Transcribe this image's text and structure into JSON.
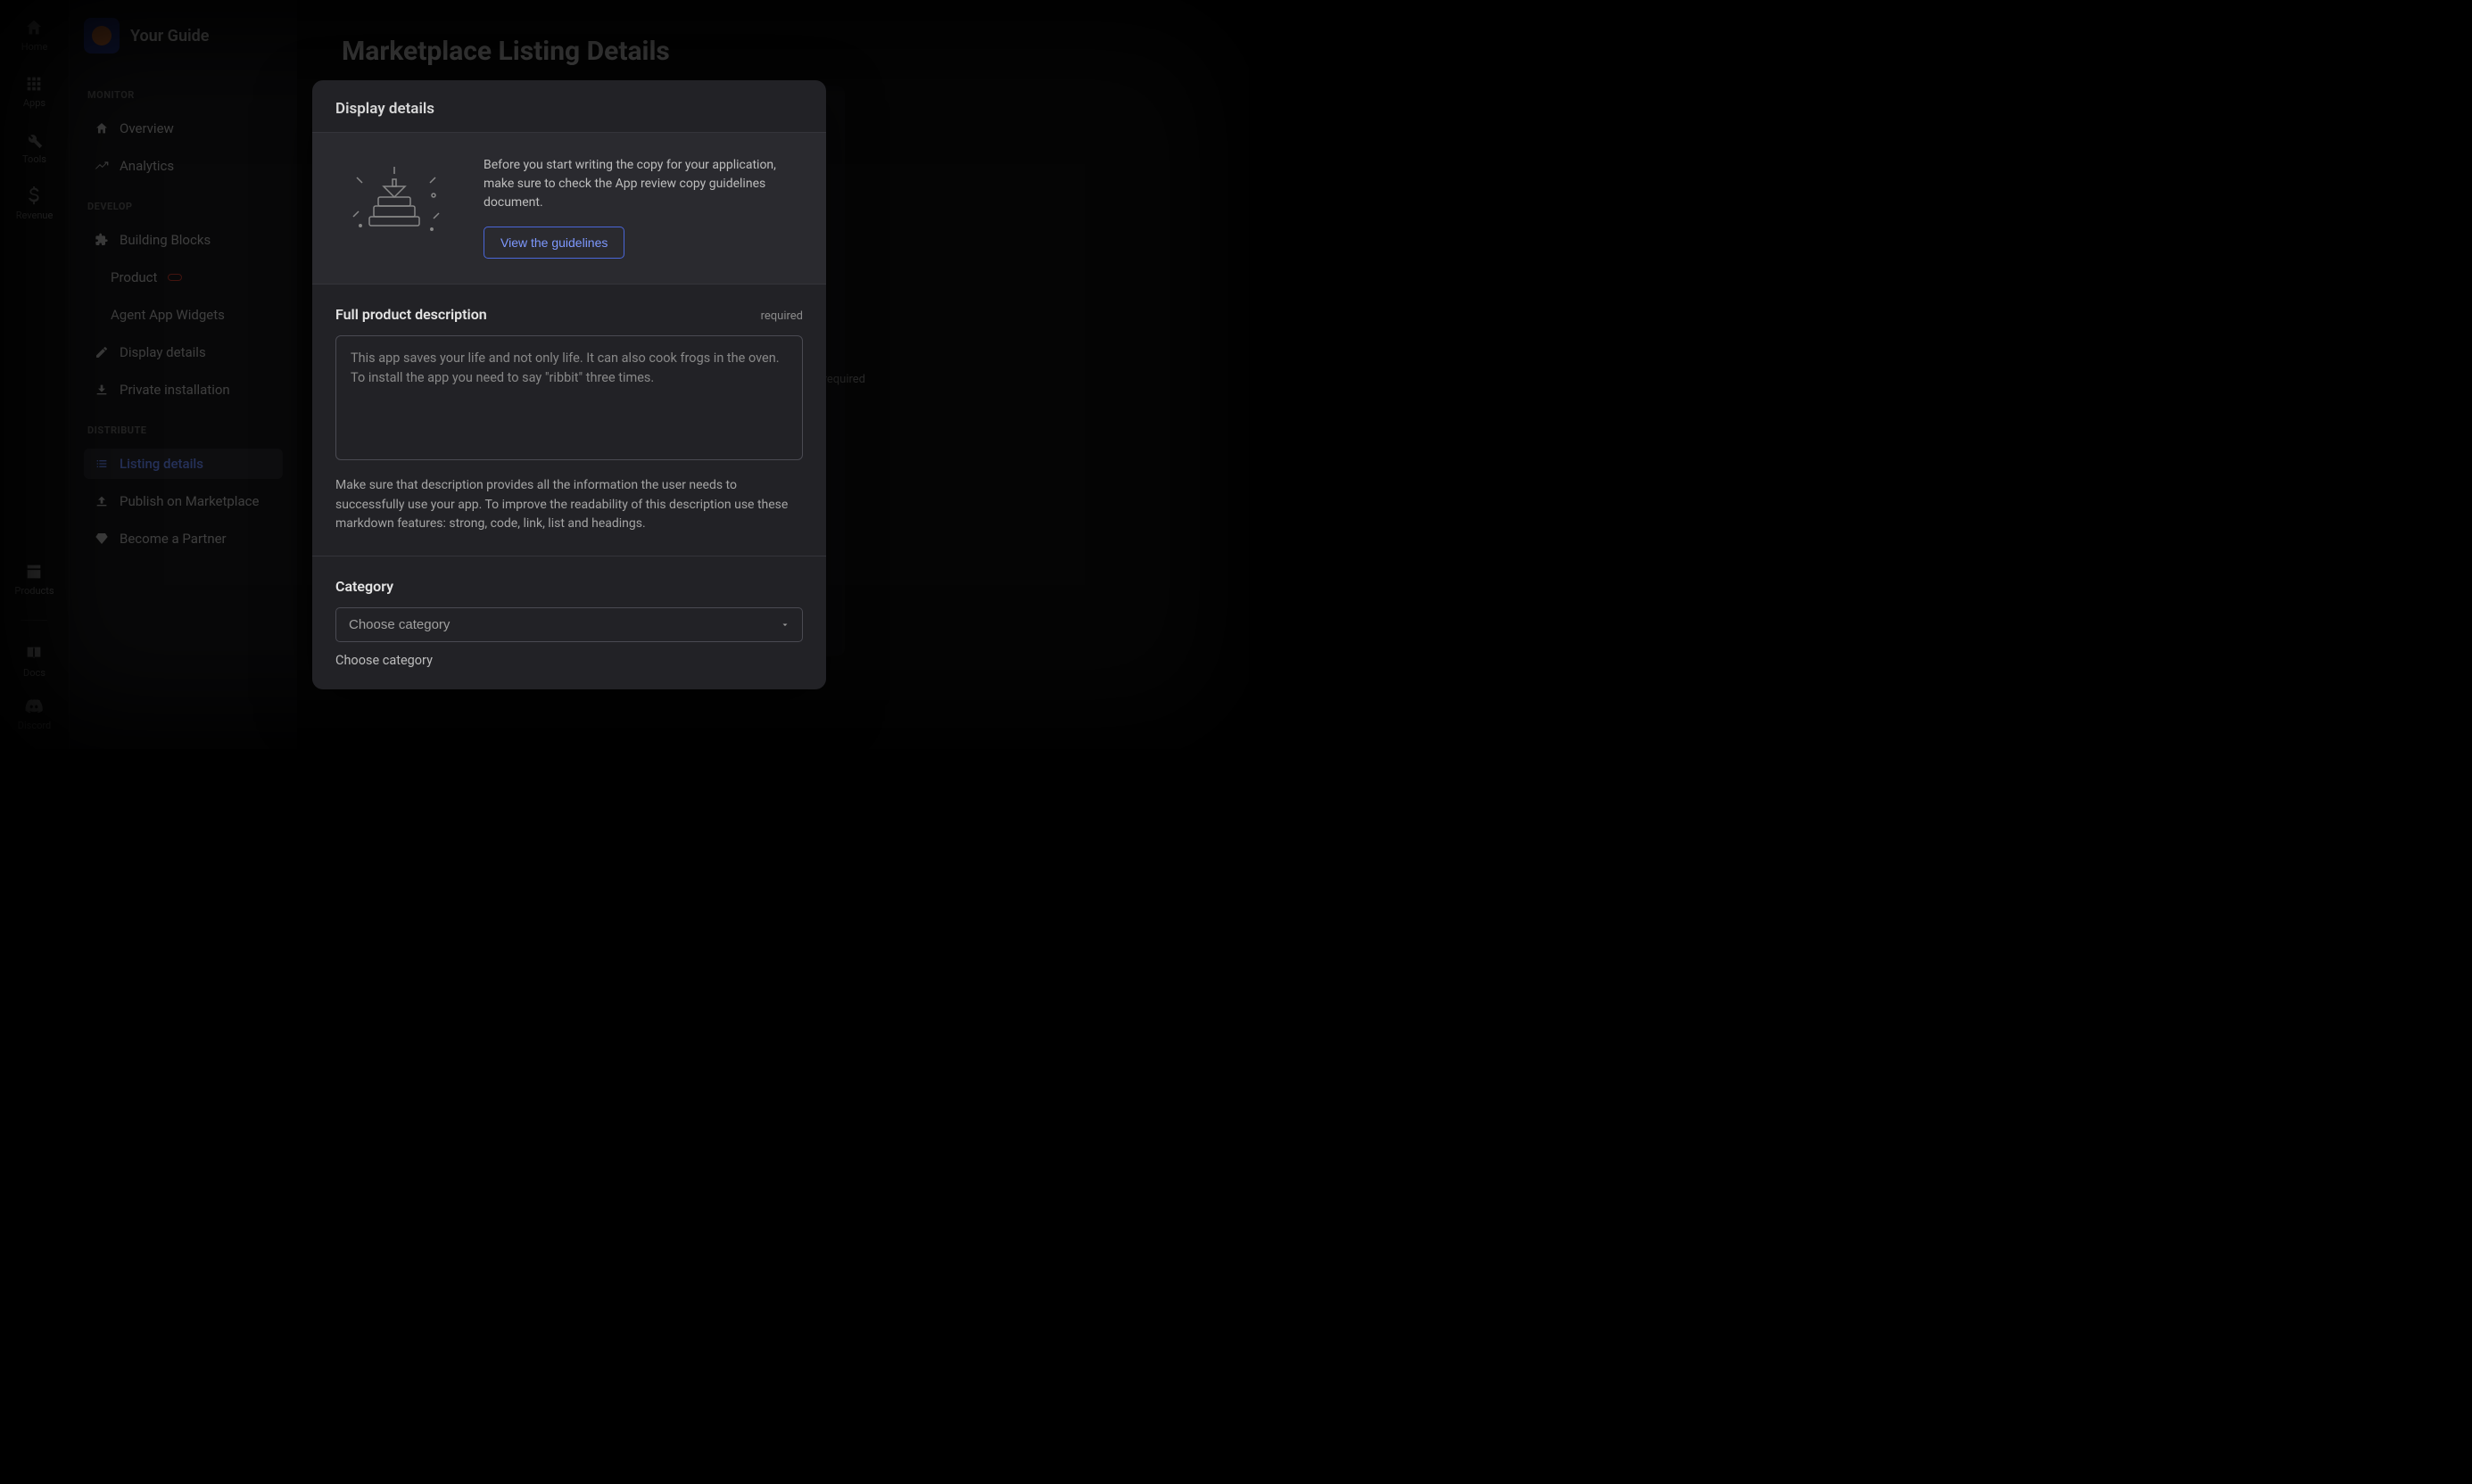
{
  "rail": {
    "top": [
      {
        "name": "home-icon",
        "label": "Home"
      },
      {
        "name": "apps-icon",
        "label": "Apps"
      },
      {
        "name": "tools-icon",
        "label": "Tools"
      },
      {
        "name": "revenue-icon",
        "label": "Revenue"
      }
    ],
    "bottom": [
      {
        "name": "products-icon",
        "label": "Products"
      },
      {
        "name": "docs-icon",
        "label": "Docs"
      },
      {
        "name": "discord-icon",
        "label": "Discord"
      }
    ]
  },
  "sidebar": {
    "app_name": "Your Guide",
    "sections": {
      "monitor": {
        "label": "MONITOR",
        "items": [
          {
            "label": "Overview",
            "icon": "home-icon"
          },
          {
            "label": "Analytics",
            "icon": "trend-icon"
          }
        ]
      },
      "develop": {
        "label": "DEVELOP",
        "items": [
          {
            "label": "Building Blocks",
            "icon": "puzzle-icon"
          },
          {
            "label": "Product",
            "icon": "",
            "indent": true,
            "badge": "pill"
          },
          {
            "label": "Agent App Widgets",
            "icon": "",
            "indent": true
          },
          {
            "label": "Display details",
            "icon": "pencil-icon"
          },
          {
            "label": "Private installation",
            "icon": "download-icon"
          }
        ]
      },
      "distribute": {
        "label": "DISTRIBUTE",
        "items": [
          {
            "label": "Listing details",
            "icon": "list-icon",
            "active": true
          },
          {
            "label": "Publish on Marketplace",
            "icon": "upload-icon"
          },
          {
            "label": "Become a Partner",
            "icon": "diamond-icon"
          }
        ]
      }
    }
  },
  "main": {
    "title": "Marketplace Listing Details",
    "ghost_required": "required"
  },
  "modal": {
    "title": "Display details",
    "guideline": {
      "text": "Before you start writing the copy for your application, make sure to check the App review copy guidelines document.",
      "button": "View the guidelines"
    },
    "description": {
      "label": "Full product description",
      "required": "required",
      "placeholder": "This app saves your life and not only life. It can also cook frogs in the oven. To install the app you need to say \"ribbit\" three times.",
      "help": "Make sure that description provides all the information the user needs to successfully use your app. To improve the readability of this description use these markdown features: strong, code, link, list and headings."
    },
    "category": {
      "label": "Category",
      "placeholder": "Choose category",
      "help": "Choose category"
    }
  }
}
